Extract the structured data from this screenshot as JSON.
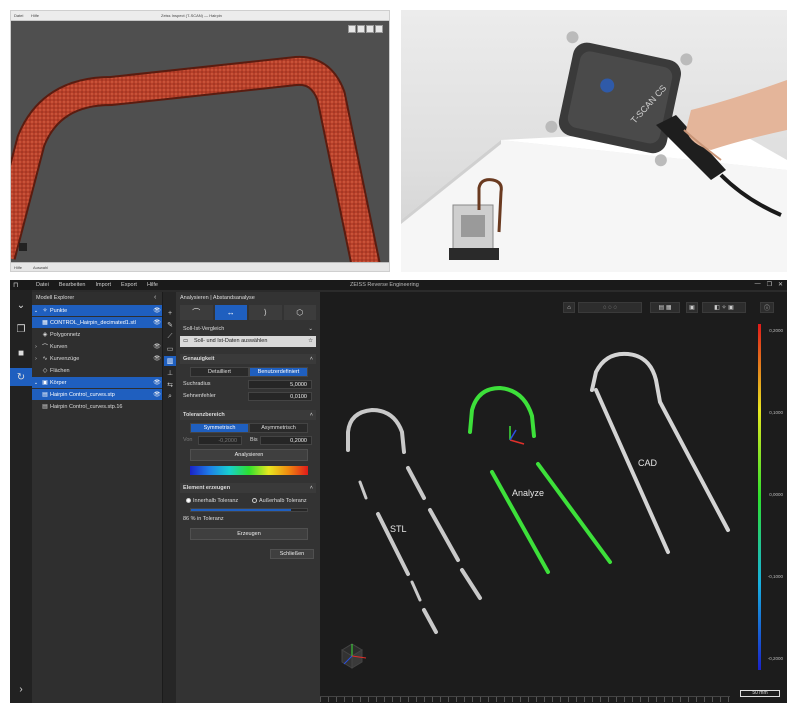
{
  "viewer": {
    "menu": [
      "Datei",
      "Hilfe"
    ],
    "title": "Zeiss Inspect (T-SCAN) — Hairpin",
    "status_left": "Hilfe",
    "status_mid": "Auswahl"
  },
  "photo": {
    "scanner_brand": "T-SCAN CS"
  },
  "app": {
    "menu": [
      "Datei",
      "Bearbeiten",
      "Import",
      "Export",
      "Hilfe"
    ],
    "title": "ZEISS Reverse Engineering",
    "window_controls": [
      "—",
      "❐",
      "✕"
    ]
  },
  "explorer": {
    "title": "Modell Explorer",
    "items": [
      {
        "label": "Punkte",
        "icon": "points-icon",
        "selected": true
      },
      {
        "label": "CONTROL_Hairpin_decimated1.stl",
        "icon": "mesh-file-icon",
        "selected": true
      },
      {
        "label": "Polygonnetz",
        "icon": "polygon-mesh-icon",
        "selected": false
      },
      {
        "label": "Kurven",
        "icon": "curves-icon",
        "selected": false
      },
      {
        "label": "Kurvenzüge",
        "icon": "polyline-icon",
        "selected": false
      },
      {
        "label": "Flächen",
        "icon": "surfaces-icon",
        "selected": false
      },
      {
        "label": "Körper",
        "icon": "body-icon",
        "selected": true
      },
      {
        "label": "Hairpin Control_curves.stp",
        "icon": "step-file-icon",
        "selected": true
      },
      {
        "label": "Hairpin Control_curves.stp.16",
        "icon": "step-file-icon",
        "selected": false
      }
    ]
  },
  "panel": {
    "title": "Analysieren | Abstandsanalyse",
    "compare_label": "Soll-Ist-Vergleich",
    "select_data": "Soll- und Ist-Daten auswählen",
    "accuracy": {
      "title": "Genauigkeit",
      "options": [
        "Detailliert",
        "Benutzerdefiniert"
      ],
      "search_radius_label": "Suchradius",
      "search_radius": "5,0000",
      "chord_error_label": "Sehnenfehler",
      "chord_error": "0,0100"
    },
    "tolerance": {
      "title": "Toleranzbereich",
      "options": [
        "Symmetrisch",
        "Asymmetrisch"
      ],
      "from_label": "Von",
      "from_value": "-0,2000",
      "to_label": "Bis",
      "to_value": "0,2000",
      "analyze_button": "Analysieren"
    },
    "element": {
      "title": "Element erzeugen",
      "inside": "Innerhalb Toleranz",
      "outside": "Außerhalb Toleranz",
      "percent_text": "86 % in Toleranz",
      "create_button": "Erzeugen"
    },
    "close_button": "Schließen"
  },
  "viewport": {
    "labels": {
      "stl": "STL",
      "analyze": "Analyze",
      "cad": "CAD"
    },
    "scale_ticks": [
      "0,2000",
      "0,1000",
      "0,0000",
      "-0,1000",
      "-0,2000"
    ],
    "scale_bar": "50 mm"
  },
  "colors": {
    "selection": "#1f5fbf",
    "analyze_green": "#3de03a",
    "tube_red": "#c8452a"
  }
}
